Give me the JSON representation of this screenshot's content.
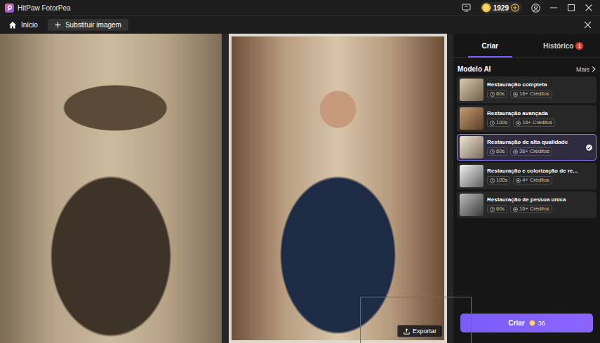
{
  "window": {
    "title": "HitPaw FotorPea"
  },
  "top_bar": {
    "coins": "1929"
  },
  "toolbar": {
    "home": "Início",
    "replace": "Substituir imagem"
  },
  "canvas": {
    "export": "Exportar"
  },
  "panel": {
    "tabs": [
      {
        "label": "Criar",
        "selected": true,
        "badge": ""
      },
      {
        "label": "Histórico",
        "selected": false,
        "badge": "1"
      }
    ],
    "section": {
      "title": "Modelo AI",
      "more": "Mais"
    },
    "models": [
      {
        "title": "Restauração completa",
        "time": "60s",
        "credits": "16+ Créditos",
        "selected": false
      },
      {
        "title": "Restauração avançada",
        "time": "100s",
        "credits": "16+ Créditos",
        "selected": false
      },
      {
        "title": "Restauração de alta qualidade",
        "time": "60s",
        "credits": "36+ Créditos",
        "selected": true
      },
      {
        "title": "Restauração e colorização de re...",
        "time": "100s",
        "credits": "4+ Créditos",
        "selected": false
      },
      {
        "title": "Restauração de pessoa única",
        "time": "60s",
        "credits": "16+ Créditos",
        "selected": false
      }
    ],
    "create": {
      "label": "Criar",
      "cost": "36"
    }
  }
}
